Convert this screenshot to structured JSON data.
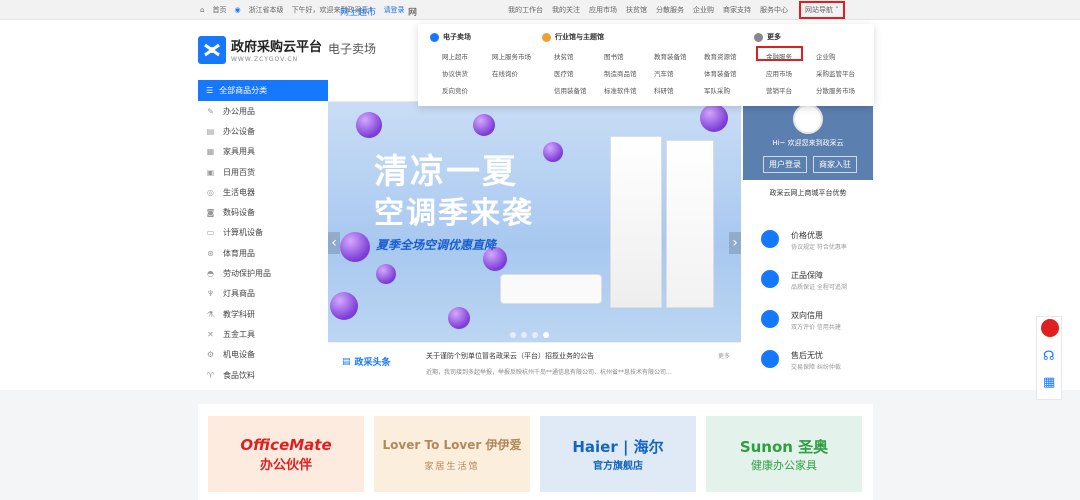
{
  "topbar": {
    "home": "首页",
    "region": "浙江省本级",
    "greeting": "下午好，欢迎来到政采云！",
    "login": "请登录",
    "links": [
      "我的工作台",
      "我的关注",
      "应用市场",
      "扶贫馆",
      "分散服务",
      "企业购",
      "商家支持",
      "服务中心"
    ],
    "site_nav": "网站导航"
  },
  "header": {
    "logo_name": "政府采购云平台",
    "logo_en": "WWW.ZCYGOV.CN",
    "section": "电子卖场"
  },
  "categories": {
    "head": "全部商品分类",
    "items": [
      "办公用品",
      "办公设备",
      "家具用具",
      "日用百货",
      "生活电器",
      "数码设备",
      "计算机设备",
      "体育用品",
      "劳动保护用品",
      "灯具商品",
      "教学科研",
      "五金工具",
      "机电设备",
      "食品饮料"
    ]
  },
  "tabs": [
    "网上超市",
    "网"
  ],
  "banner": {
    "line1": "清凉一夏",
    "line2": "空调季来袭",
    "sub": "夏季全场空调优惠直降",
    "dots": 4,
    "active_dot": 4
  },
  "notice": {
    "badge": "政采头条",
    "headline": "关于谨防个别单位冒名政采云（平台）招揽业务的公告",
    "more": "更多",
    "body": "近期，我司接到多起举报，举报反映杭州千岛**通信息有限公司、杭州省**息技术有限公司..."
  },
  "user_panel": {
    "hi": "Hi~ 欢迎您来到政采云",
    "login_btn": "用户登录",
    "merchant_btn": "商家入驻",
    "advantages_title": "政采云网上商城平台优势",
    "advantages": [
      {
        "name": "价格优惠",
        "desc": "协议规定 符合优惠率"
      },
      {
        "name": "正品保障",
        "desc": "品质保证 全程可追溯"
      },
      {
        "name": "双向信用",
        "desc": "双方评价 信用共建"
      },
      {
        "name": "售后无忧",
        "desc": "交易保障 纠纷仲裁"
      }
    ]
  },
  "dropdown": {
    "col1_title": "电子卖场",
    "col1_items": [
      "网上超市",
      "网上服务市场",
      "协议供货",
      "在线询价",
      "反向竞价"
    ],
    "col2_title": "行业馆与主题馆",
    "col2_items": [
      "扶贫馆",
      "图书馆",
      "教育装备馆",
      "教育资源馆",
      "医疗馆",
      "制造商品馆",
      "汽车馆",
      "体育装备馆",
      "信用装备馆",
      "标准软件馆",
      "科研馆",
      "军队采购"
    ],
    "col3_title": "更多",
    "col3_items": [
      "金融服务",
      "企业购",
      "应用市场",
      "采购监管平台",
      "营销平台",
      "分散服务市场"
    ],
    "highlighted": "金融服务"
  },
  "brands": [
    {
      "name": "OfficeMate",
      "sub": "办公伙伴",
      "color": "#e02020"
    },
    {
      "name": "Lover To Lover 伊伊爱",
      "sub": "家居生活馆",
      "color": "#b08a5a"
    },
    {
      "name": "Haier | 海尔",
      "sub": "官方旗舰店",
      "color": "#1565c0"
    },
    {
      "name": "Sunon 圣奥",
      "sub": "健康办公家具",
      "color": "#2e9e3f"
    }
  ],
  "colors": {
    "brand": "#1677ff",
    "highlight": "#e02020"
  }
}
